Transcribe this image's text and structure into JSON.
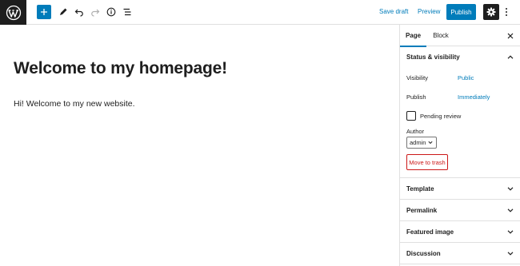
{
  "toolbar": {
    "logo_icon": "wordpress-logo-icon",
    "add_block_icon": "plus-icon",
    "tools_icon": "pencil-icon",
    "undo_icon": "undo-icon",
    "redo_icon": "redo-icon",
    "details_icon": "info-icon",
    "outline_icon": "list-view-icon",
    "save_draft_label": "Save draft",
    "preview_label": "Preview",
    "publish_label": "Publish",
    "settings_icon": "gear-icon",
    "more_icon": "more-vertical-icon",
    "accent_color": "#007cba"
  },
  "editor": {
    "title": "Welcome to my homepage!",
    "paragraph": "Hi! Welcome to my new website."
  },
  "sidebar": {
    "tabs": [
      {
        "label": "Page",
        "active": true
      },
      {
        "label": "Block",
        "active": false
      }
    ],
    "close_icon": "close-icon",
    "status_visibility": {
      "title": "Status & visibility",
      "expanded": true,
      "visibility_label": "Visibility",
      "visibility_value": "Public",
      "publish_label": "Publish",
      "publish_value": "Immediately",
      "pending_review_label": "Pending review",
      "pending_review_checked": false,
      "author_label": "Author",
      "author_value": "admin",
      "trash_label": "Move to trash"
    },
    "panels": [
      {
        "title": "Template"
      },
      {
        "title": "Permalink"
      },
      {
        "title": "Featured image"
      },
      {
        "title": "Discussion"
      }
    ]
  }
}
